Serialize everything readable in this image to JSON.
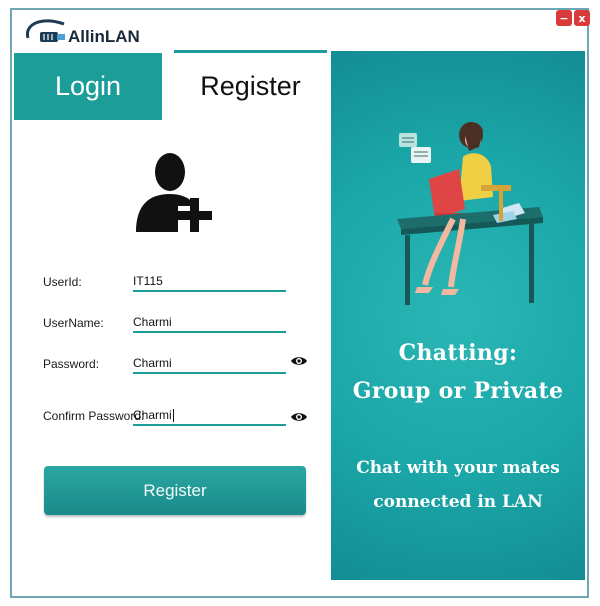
{
  "app": {
    "logo_text": "AllinLAN"
  },
  "window_controls": {
    "minimize": "−",
    "close": "x"
  },
  "tabs": {
    "login": "Login",
    "register": "Register"
  },
  "form": {
    "userid": {
      "label": "UserId:",
      "value": "IT115"
    },
    "username": {
      "label": "UserName:",
      "value": "Charmi"
    },
    "password": {
      "label": "Password:",
      "value": "Charmi"
    },
    "confirm": {
      "label": "Confirm Password:",
      "value": "Charmi"
    }
  },
  "actions": {
    "register_button": "Register"
  },
  "promo": {
    "line1": "Chatting:",
    "line2": "Group or Private",
    "line3": "Chat with your mates",
    "line4": "connected in LAN"
  },
  "colors": {
    "teal": "#1d9d97",
    "panel": "#1ba6a7",
    "close_red": "#d93a3a"
  },
  "icons": [
    "network-cable-icon",
    "add-user-icon",
    "eye-icon",
    "minimize-icon",
    "close-icon"
  ]
}
